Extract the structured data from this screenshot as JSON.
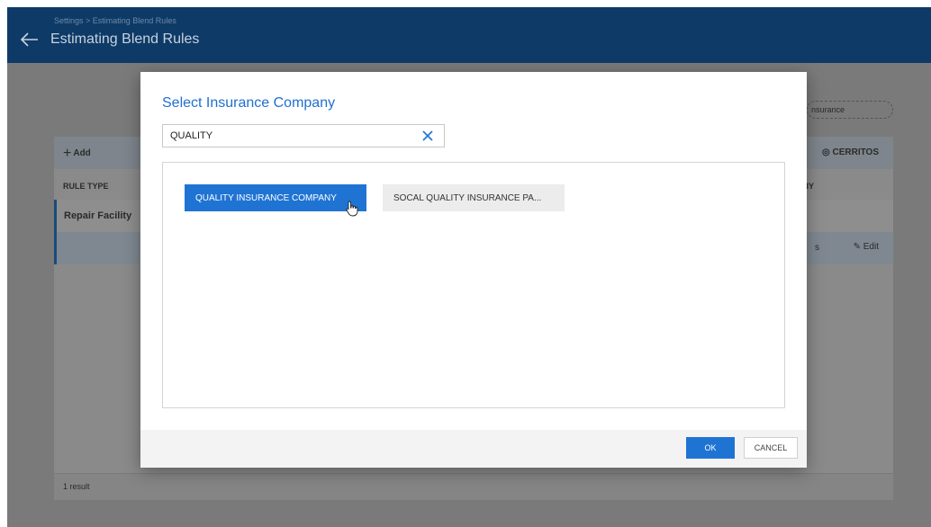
{
  "header": {
    "breadcrumb": "Settings > Estimating Blend Rules",
    "title": "Estimating Blend Rules"
  },
  "background": {
    "add_label": "Add",
    "location": "CERRITOS",
    "insurance_pill": "nsurance",
    "col_rule_type": "RULE TYPE",
    "col_right": "IY",
    "row1_label": "Repair Facility",
    "row2_right": "s",
    "edit_label": "Edit",
    "result_count": "1 result"
  },
  "modal": {
    "title": "Select Insurance Company",
    "search_value": "QUALITY",
    "options": [
      {
        "label": "QUALITY INSURANCE COMPANY",
        "selected": true
      },
      {
        "label": "SOCAL QUALITY INSURANCE PA...",
        "selected": false
      }
    ],
    "ok_label": "OK",
    "cancel_label": "CANCEL"
  },
  "colors": {
    "header_bg": "#0e3a67",
    "accent": "#1f74d3",
    "title_blue": "#1f6fd1"
  }
}
